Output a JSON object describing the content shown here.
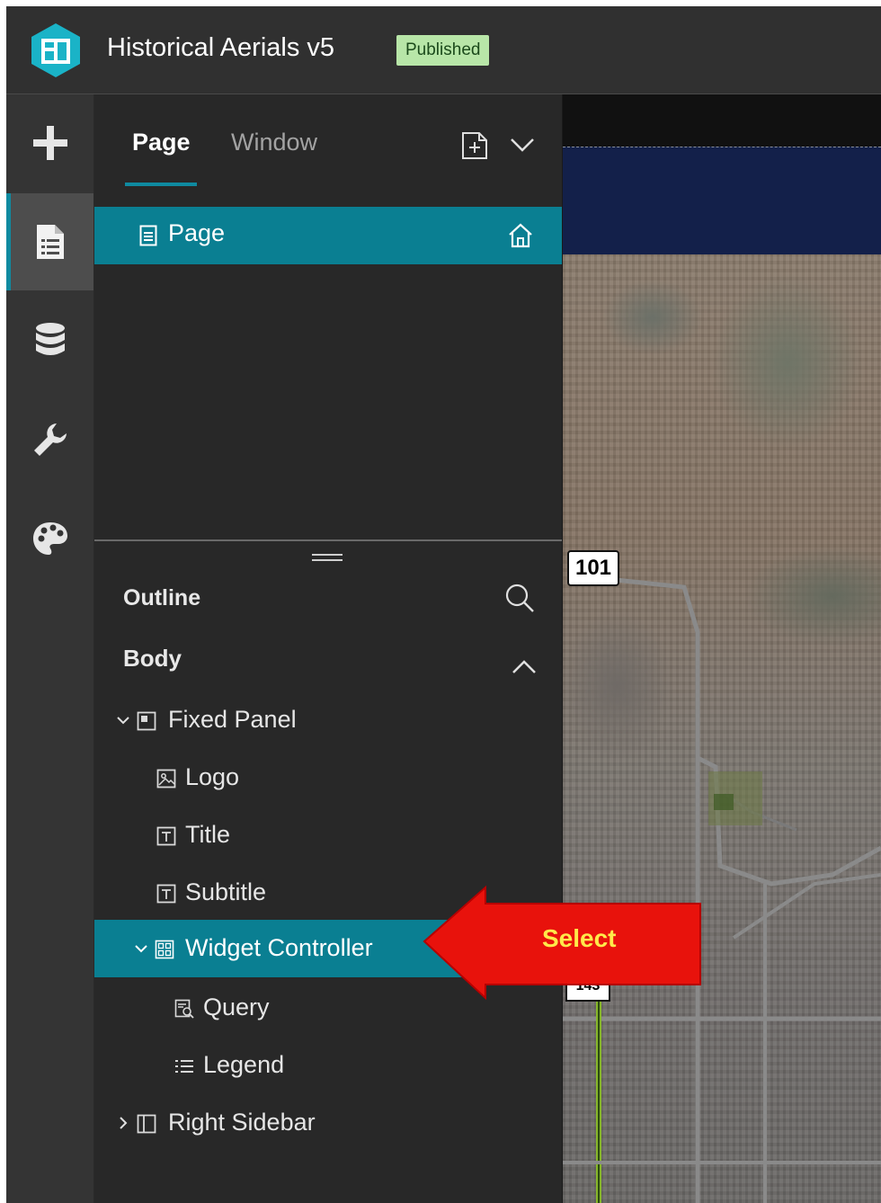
{
  "header": {
    "title": "Historical Aerials v5",
    "status_badge": "Published",
    "logo_icon": "experience-builder-logo-icon"
  },
  "rail": {
    "items": [
      {
        "icon": "plus-icon",
        "active": false
      },
      {
        "icon": "page-document-icon",
        "active": true
      },
      {
        "icon": "data-database-icon",
        "active": false
      },
      {
        "icon": "wrench-icon",
        "active": false
      },
      {
        "icon": "palette-icon",
        "active": false
      }
    ]
  },
  "panel": {
    "tabs": [
      {
        "label": "Page",
        "active": true
      },
      {
        "label": "Window",
        "active": false
      }
    ],
    "add_page_icon": "add-page-icon",
    "dropdown_icon": "chevron-down-icon",
    "pages": [
      {
        "label": "Page",
        "selected": true,
        "is_home": true
      }
    ],
    "outline": {
      "label": "Outline",
      "search_icon": "search-icon",
      "body_label": "Body",
      "tree": [
        {
          "label": "Fixed Panel",
          "icon": "fixed-panel-icon",
          "expandable": true,
          "expanded": true,
          "selected": false
        },
        {
          "label": "Logo",
          "icon": "image-icon",
          "expandable": false,
          "selected": false
        },
        {
          "label": "Title",
          "icon": "text-icon",
          "expandable": false,
          "selected": false
        },
        {
          "label": "Subtitle",
          "icon": "text-icon",
          "expandable": false,
          "selected": false
        },
        {
          "label": "Widget Controller",
          "icon": "widget-controller-icon",
          "expandable": true,
          "expanded": true,
          "selected": true
        },
        {
          "label": "Query",
          "icon": "query-icon",
          "expandable": false,
          "selected": false
        },
        {
          "label": "Legend",
          "icon": "legend-icon",
          "expandable": false,
          "selected": false
        },
        {
          "label": "Right Sidebar",
          "icon": "sidebar-icon",
          "expandable": true,
          "expanded": false,
          "selected": false
        }
      ]
    }
  },
  "map": {
    "route_shield": "101",
    "route_shield_partial": "143"
  },
  "annotation": {
    "label": "Select",
    "arrow_color": "#e8120c",
    "text_color": "#ffe94a"
  },
  "colors": {
    "accent": "#0a7f92",
    "badge_bg": "#b8e6a8"
  }
}
